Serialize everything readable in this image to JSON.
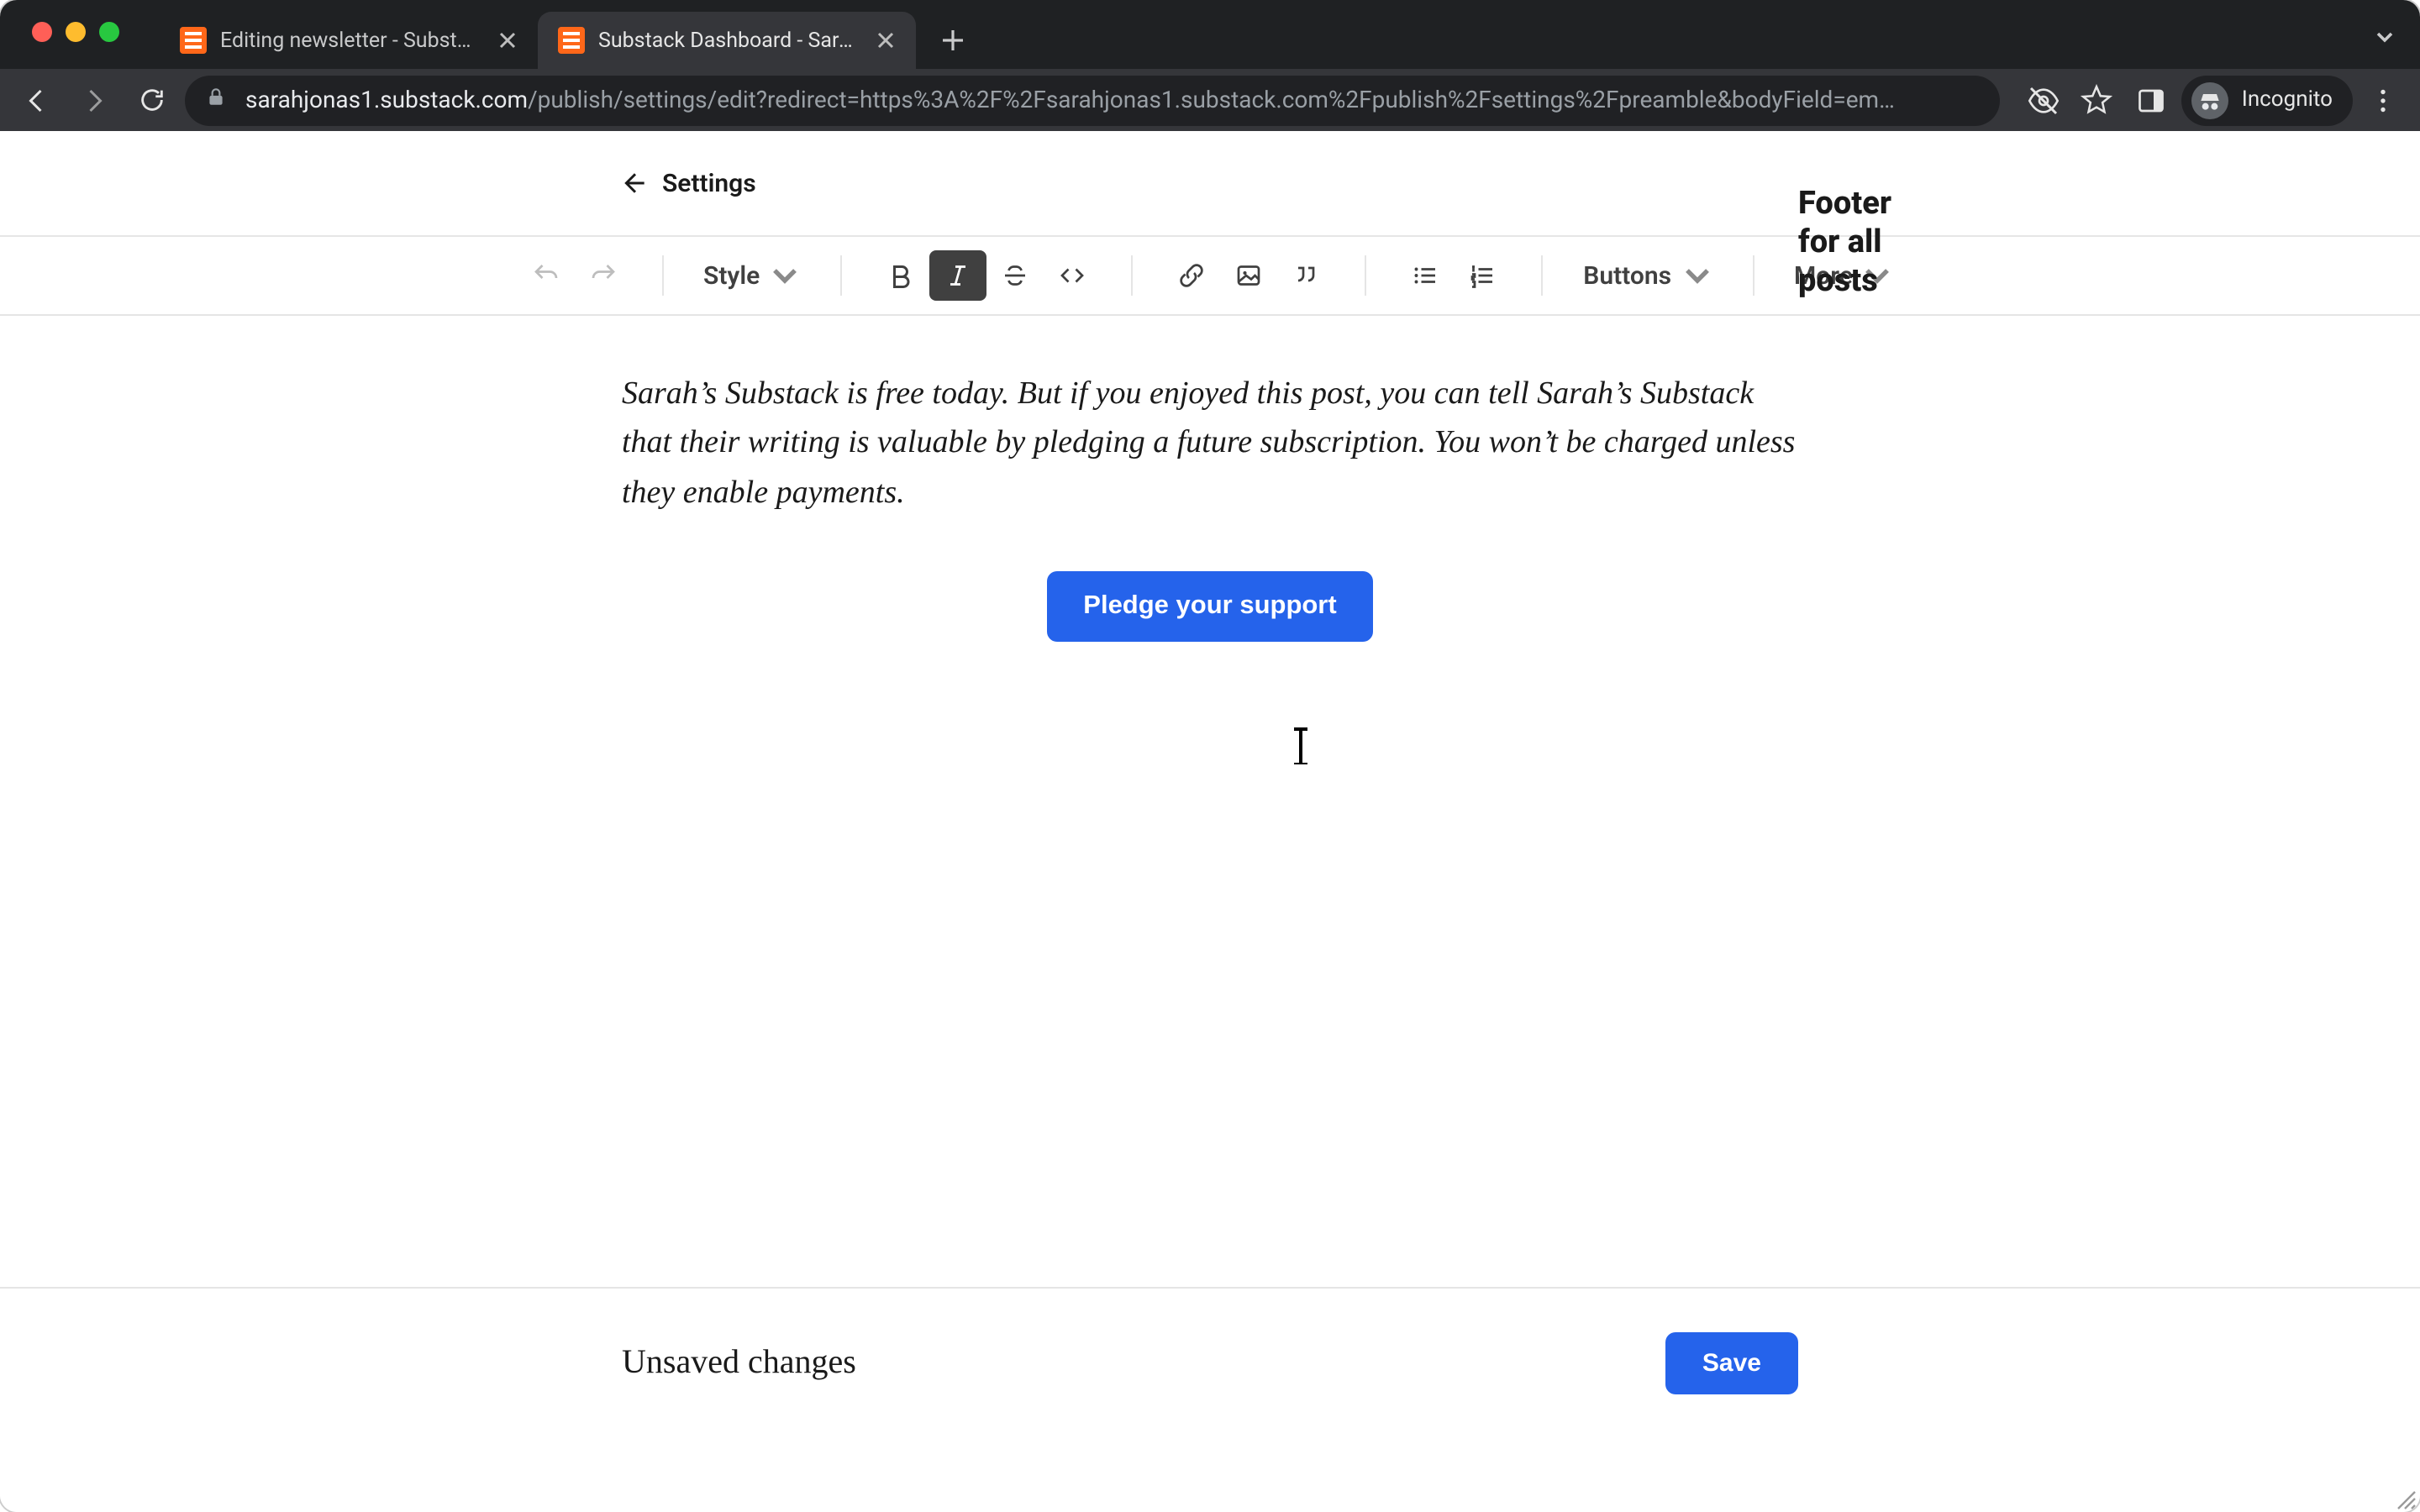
{
  "browser": {
    "tabs": [
      {
        "title": "Editing newsletter - Substack",
        "active": false
      },
      {
        "title": "Substack Dashboard - Sarah's",
        "active": true
      }
    ],
    "url_host": "sarahjonas1.substack.com",
    "url_rest": "/publish/settings/edit?redirect=https%3A%2F%2Fsarahjonas1.substack.com%2Fpublish%2Fsettings%2Fpreamble&bodyField=em…",
    "incognito_label": "Incognito"
  },
  "header": {
    "back_label": "Settings",
    "page_title": "Footer for all posts"
  },
  "toolbar": {
    "style_label": "Style",
    "buttons_label": "Buttons",
    "more_label": "More"
  },
  "editor": {
    "paragraph": "Sarah’s Substack is free today. But if you enjoyed this post, you can tell Sarah’s Substack that their writing is valuable by pledging a future subscription. You won’t be charged unless they enable payments.",
    "pledge_button": "Pledge your support"
  },
  "savebar": {
    "status": "Unsaved changes",
    "save_label": "Save"
  },
  "colors": {
    "primary": "#2563eb"
  }
}
